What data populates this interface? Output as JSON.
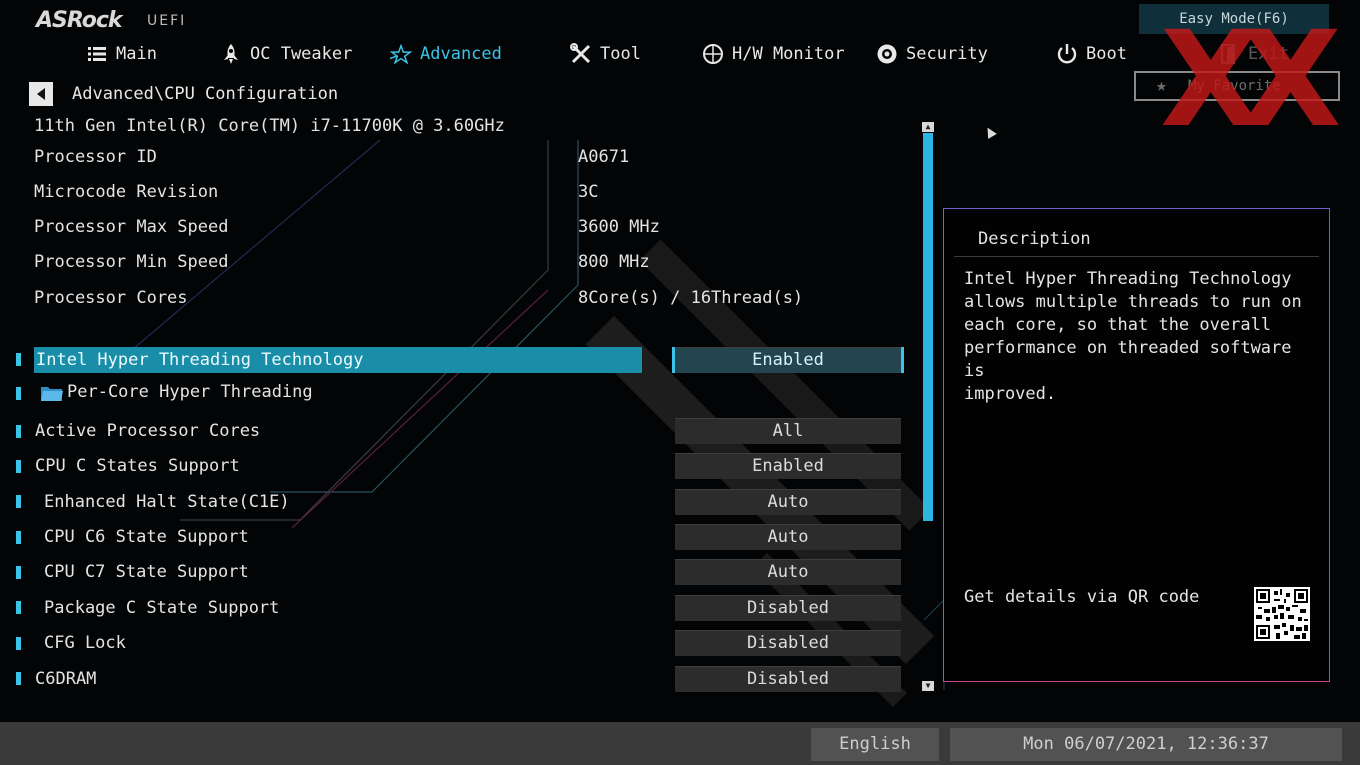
{
  "header": {
    "logo": "ASRock",
    "firmware": "UEFI",
    "easy_mode": "Easy Mode(F6)",
    "my_favorite": "My Favorite",
    "watermark": "XX"
  },
  "nav": [
    {
      "label": "Main",
      "icon": "list-icon",
      "active": false
    },
    {
      "label": "OC Tweaker",
      "icon": "rocket-icon",
      "active": false
    },
    {
      "label": "Advanced",
      "icon": "star-icon",
      "active": true
    },
    {
      "label": "Tool",
      "icon": "tools-icon",
      "active": false
    },
    {
      "label": "H/W Monitor",
      "icon": "monitor-icon",
      "active": false
    },
    {
      "label": "Security",
      "icon": "shield-icon",
      "active": false
    },
    {
      "label": "Boot",
      "icon": "power-icon",
      "active": false
    },
    {
      "label": "Exit",
      "icon": "exit-icon",
      "active": false
    }
  ],
  "breadcrumb": "Advanced\\CPU Configuration",
  "cpu_name": "11th Gen Intel(R) Core(TM) i7-11700K @ 3.60GHz",
  "info": [
    {
      "label": "Processor ID",
      "value": "A0671"
    },
    {
      "label": "Microcode Revision",
      "value": "3C"
    },
    {
      "label": "Processor Max Speed",
      "value": "3600 MHz"
    },
    {
      "label": "Processor Min Speed",
      "value": "800 MHz"
    },
    {
      "label": "Processor Cores",
      "value": "8Core(s) / 16Thread(s)"
    }
  ],
  "options": [
    {
      "label": "Intel Hyper Threading Technology",
      "value": "Enabled",
      "selected": true
    },
    {
      "label": "Per-Core Hyper Threading",
      "value": "",
      "folder": true
    },
    {
      "label": "Active Processor Cores",
      "value": "All"
    },
    {
      "label": "CPU C States Support",
      "value": "Enabled"
    },
    {
      "label": "Enhanced Halt State(C1E)",
      "value": "Auto"
    },
    {
      "label": "CPU C6 State Support",
      "value": "Auto"
    },
    {
      "label": "CPU C7 State Support",
      "value": "Auto"
    },
    {
      "label": "Package C State Support",
      "value": "Disabled"
    },
    {
      "label": "CFG Lock",
      "value": "Disabled"
    },
    {
      "label": "C6DRAM",
      "value": "Disabled"
    }
  ],
  "description": {
    "title": "Description",
    "text": "Intel Hyper Threading Technology\nallows multiple threads to run on\neach core, so that the overall\nperformance on threaded software is\nimproved.",
    "qr_label": "Get details via QR code"
  },
  "footer": {
    "language": "English",
    "datetime": "Mon 06/07/2021, 12:36:37"
  },
  "colors": {
    "accent": "#3cc3e8",
    "selected_bg": "#1a8ea8",
    "watermark": "#c41818"
  }
}
